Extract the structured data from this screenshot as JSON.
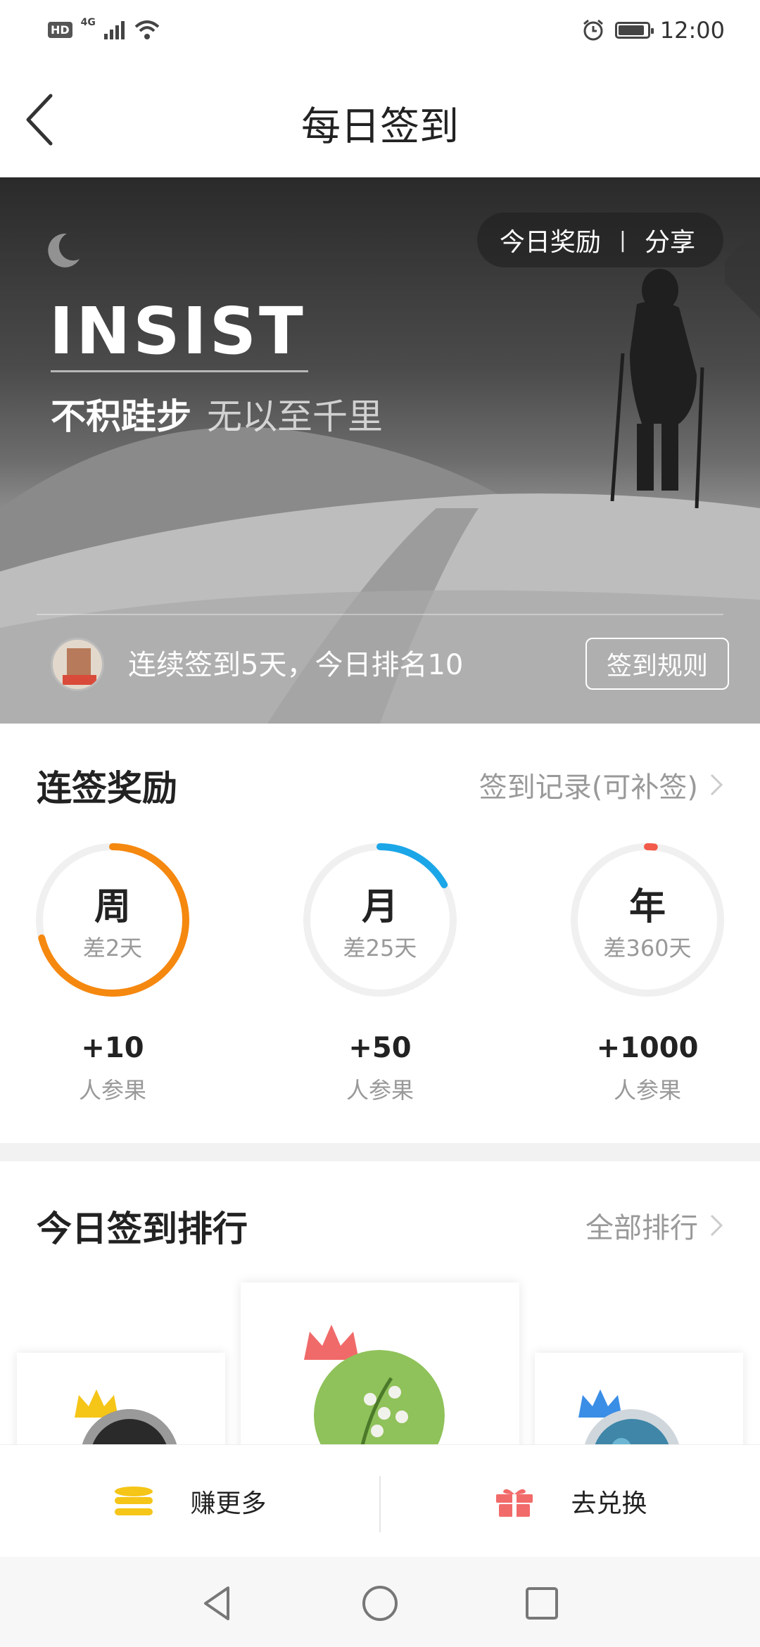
{
  "status_bar": {
    "time": "12:00",
    "left_badge": "HD",
    "network": "4G",
    "icons": [
      "hd-icon",
      "signal-icon",
      "wifi-icon",
      "alarm-icon",
      "battery-icon"
    ]
  },
  "header": {
    "title": "每日签到",
    "back_icon": "chevron-left-icon"
  },
  "hero": {
    "actions": {
      "today_reward": "今日奖励",
      "separator": "|",
      "share": "分享"
    },
    "headline": "INSIST",
    "slogan_bold": "不积跬步",
    "slogan_light": "无以至千里",
    "streak_text": "连续签到5天，今日排名10",
    "rules_button": "签到规则"
  },
  "rewards": {
    "title": "连签奖励",
    "record_link": "签到记录(可补签)",
    "items": [
      {
        "period": "周",
        "remaining": "差2天",
        "points": "+10",
        "label": "人参果",
        "progress": 0.71,
        "color": "#F5880F"
      },
      {
        "period": "月",
        "remaining": "差25天",
        "points": "+50",
        "label": "人参果",
        "progress": 0.17,
        "color": "#1BA6E8"
      },
      {
        "period": "年",
        "remaining": "差360天",
        "points": "+1000",
        "label": "人参果",
        "progress": 0.015,
        "color": "#F25A4A"
      }
    ],
    "track_color": "#F0F0F0"
  },
  "ranking": {
    "title": "今日签到排行",
    "all_link": "全部排行",
    "crown_colors": {
      "first": "#F06A6A",
      "second": "#F5C518",
      "third": "#3A8EE6"
    }
  },
  "bottom_bar": {
    "earn_more": "赚更多",
    "redeem": "去兑换",
    "earn_icon": "coin-stack-icon",
    "redeem_icon": "gift-icon",
    "earn_color": "#F5C518",
    "redeem_color": "#F26B6B"
  },
  "system_nav": {
    "icons": [
      "nav-back-icon",
      "nav-home-icon",
      "nav-recent-icon"
    ]
  }
}
